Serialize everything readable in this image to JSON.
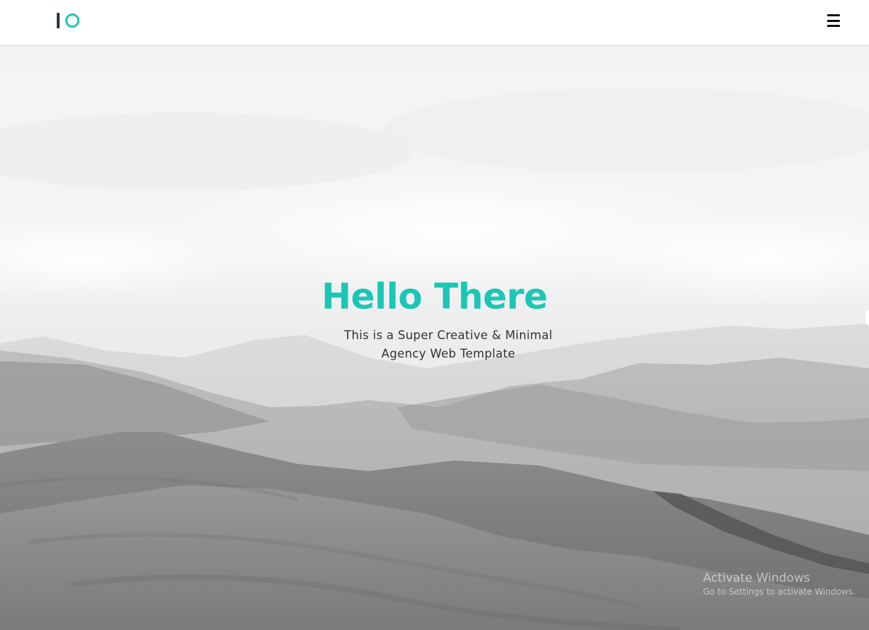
{
  "header": {
    "logo_name": "IO logo",
    "menu_icon": "hamburger-menu-icon"
  },
  "hero": {
    "title": "Hello There",
    "subtitle_line1": "This is a Super Creative & Minimal",
    "subtitle_line2": "Agency Web Template",
    "background": "grayscale mountain landscape"
  },
  "watermark": {
    "title": "Activate Windows",
    "subtitle": "Go to Settings to activate Windows."
  },
  "colors": {
    "accent": "#1cc6b6",
    "logo_dark": "#1f3b4d",
    "text": "#333333"
  }
}
